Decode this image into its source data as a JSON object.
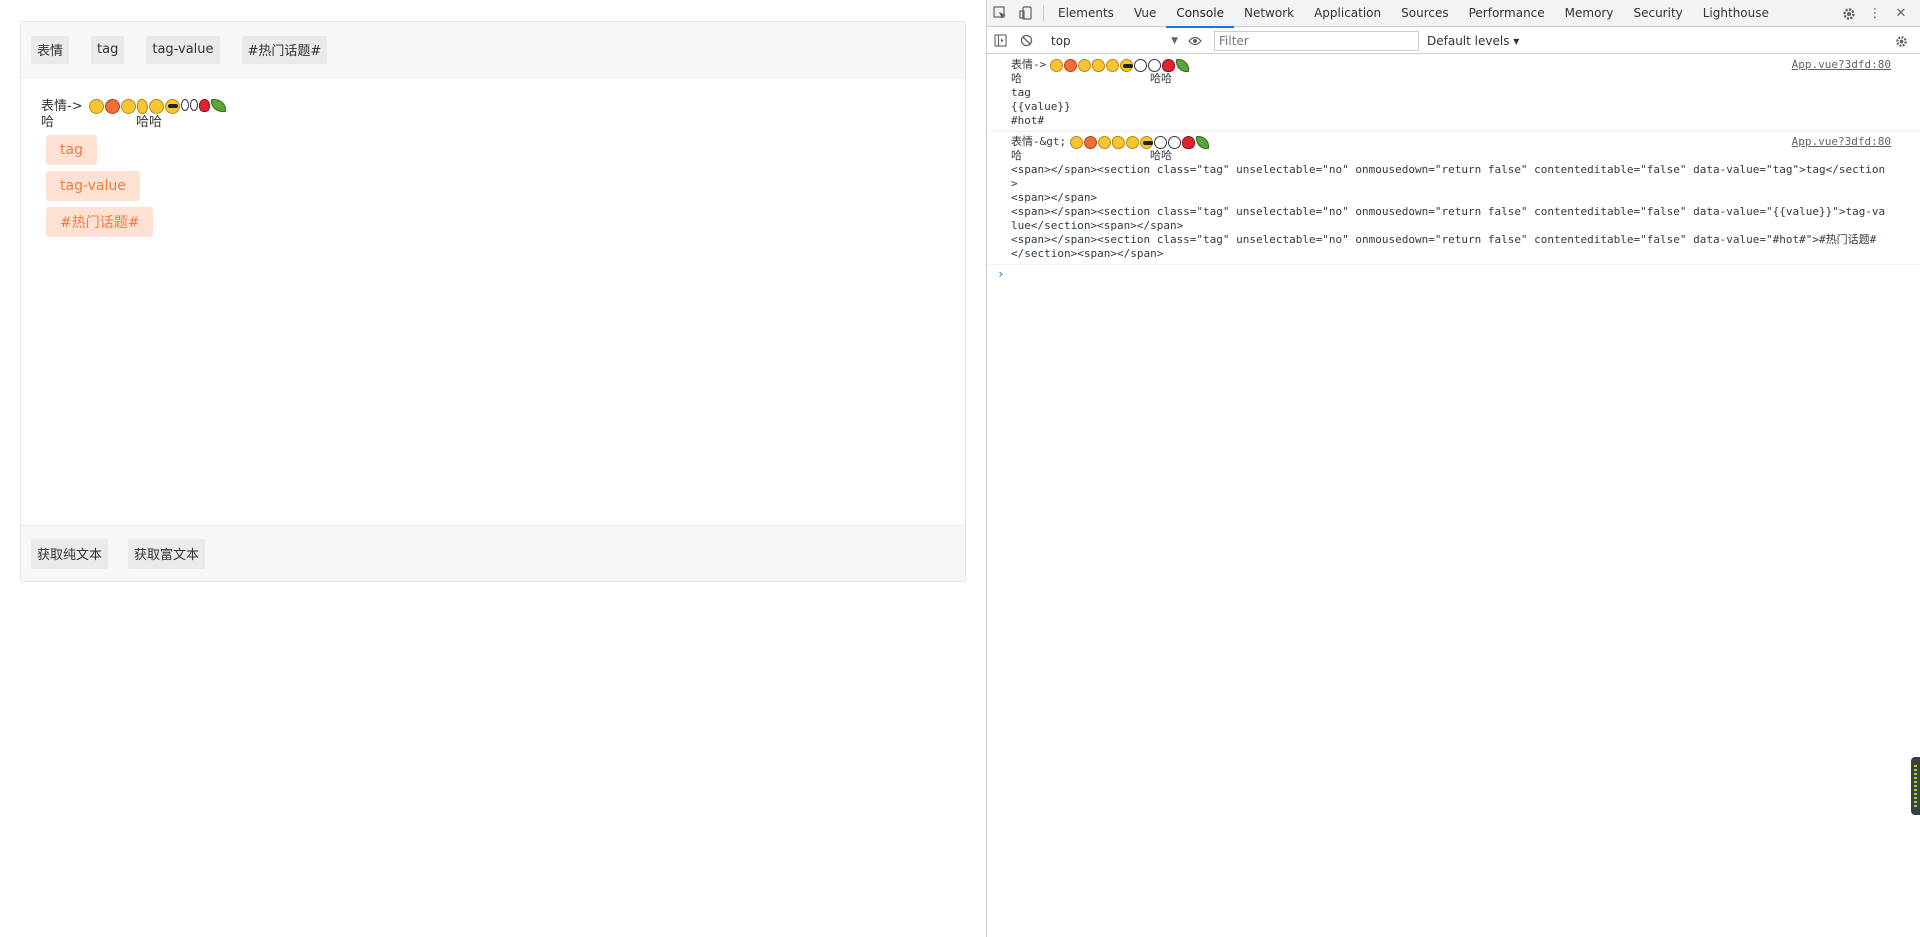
{
  "app": {
    "toolbar": {
      "emoji": "表情",
      "tag": "tag",
      "tag_value": "tag-value",
      "hot_topic": "#热门话题#"
    },
    "editor": {
      "emoji_prefix": "表情->",
      "haha_1": "哈",
      "haha_2": "哈哈",
      "chips": [
        "tag",
        "tag-value",
        "#热门话题#"
      ]
    },
    "bottom_toolbar": {
      "get_plain_text": "获取纯文本",
      "get_rich_text": "获取富文本"
    }
  },
  "devtools": {
    "tabs": [
      "Elements",
      "Vue",
      "Console",
      "Network",
      "Application",
      "Sources",
      "Performance",
      "Memory",
      "Security",
      "Lighthouse"
    ],
    "active_tab": "Console",
    "context": "top",
    "filter_placeholder": "Filter",
    "levels": "Default levels ▾",
    "messages": [
      {
        "source": "App.vue?3dfd:80",
        "prefix": "表情->",
        "haha_1": "哈",
        "haha_2": "哈哈",
        "rest": "tag\n{{value}}\n#hot#"
      },
      {
        "source": "App.vue?3dfd:80",
        "prefix": "表情-&gt;",
        "haha_1": "哈",
        "haha_2": "哈哈",
        "rest": "<span></span><section class=\"tag\" unselectable=\"no\" onmousedown=\"return false\" contenteditable=\"false\" data-value=\"tag\">tag</section>\n<span></span>\n<span></span><section class=\"tag\" unselectable=\"no\" onmousedown=\"return false\" contenteditable=\"false\" data-value=\"{{value}}\">tag-value</section><span></span>\n<span></span><section class=\"tag\" unselectable=\"no\" onmousedown=\"return false\" contenteditable=\"false\" data-value=\"#hot#\">#热门话题#\n</section><span></span>"
      }
    ],
    "prompt": "›"
  },
  "icons": {
    "inspect": "inspect-icon",
    "device": "device-toggle-icon",
    "settings": "gear-icon",
    "more": "more-vert-icon",
    "close": "close-icon",
    "sidebar": "sidebar-toggle-icon",
    "clear": "clear-console-icon",
    "eye": "live-expression-icon"
  },
  "colors": {
    "chip_bg": "#fde1d3",
    "chip_text": "#f17a3d",
    "active_tab": "#1a73e8"
  }
}
